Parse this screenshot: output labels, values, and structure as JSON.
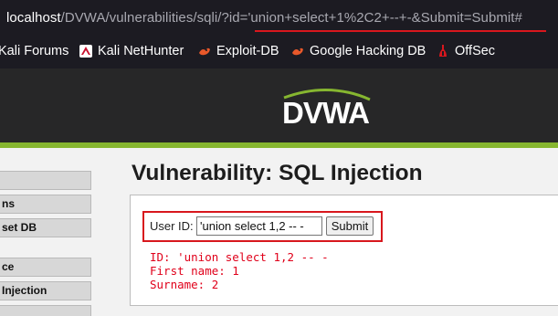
{
  "browser": {
    "url_host": "localhost",
    "url_rest": "/DVWA/vulnerabilities/sqli/?id='union+select+1%2C2+--+-&Submit=Submit#"
  },
  "bookmarks": [
    {
      "label": "Kali Forums",
      "icon": "kali-forums-icon"
    },
    {
      "label": "Kali NetHunter",
      "icon": "nethunter-icon"
    },
    {
      "label": "Exploit-DB",
      "icon": "exploit-db-icon"
    },
    {
      "label": "Google Hacking DB",
      "icon": "ghdb-icon"
    },
    {
      "label": "OffSec",
      "icon": "offsec-icon"
    }
  ],
  "header": {
    "logo_text": "DVWA"
  },
  "menu": [
    {
      "label": "",
      "active": false
    },
    {
      "label": "ns",
      "active": false
    },
    {
      "label": "set DB",
      "active": false
    },
    {
      "label": "ce",
      "active": false
    },
    {
      "label": "Injection",
      "active": true
    },
    {
      "label": "",
      "active": false
    }
  ],
  "main": {
    "title": "Vulnerability: SQL Injection",
    "form": {
      "label": "User ID:",
      "input_value": "'union select 1,2 -- -",
      "submit_label": "Submit"
    },
    "output": {
      "id_line": "ID: 'union select 1,2 -- -",
      "first_name_line": "First name: 1",
      "surname_line": "Surname: 2"
    }
  },
  "colors": {
    "highlight": "#d8171d",
    "dvwa_green": "#86b630",
    "output_red": "#e0001a"
  }
}
